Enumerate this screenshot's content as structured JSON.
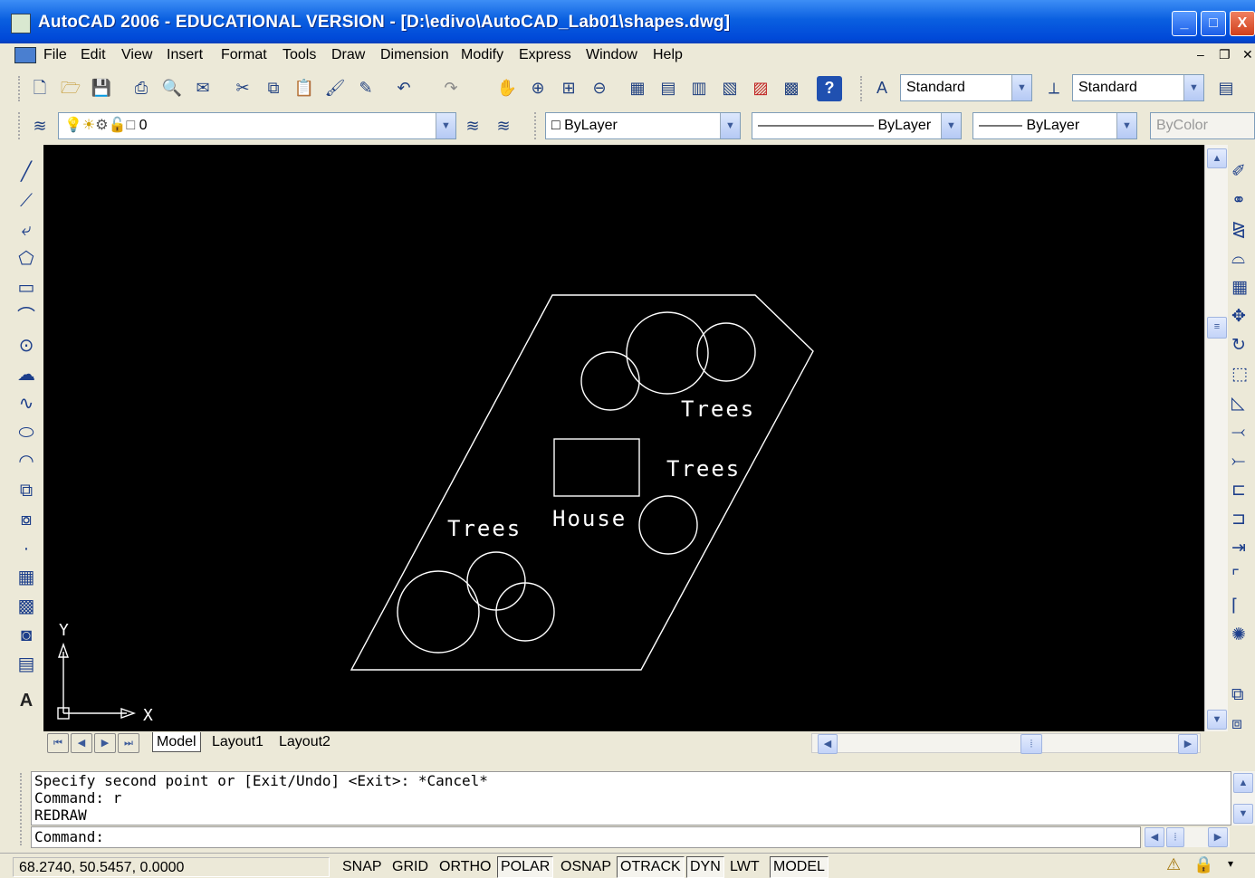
{
  "window": {
    "title": "AutoCAD 2006 - EDUCATIONAL VERSION - [D:\\edivo\\AutoCAD_Lab01\\shapes.dwg]",
    "minimize": "_",
    "maximize": "□",
    "close": "X"
  },
  "menu": [
    "File",
    "Edit",
    "View",
    "Insert",
    "Format",
    "Tools",
    "Draw",
    "Dimension",
    "Modify",
    "Express",
    "Window",
    "Help"
  ],
  "styles": {
    "text_style": "Standard",
    "dim_style": "Standard"
  },
  "layers": {
    "current_layer": "0",
    "color": "ByLayer",
    "linetype": "ByLayer",
    "lineweight": "ByLayer",
    "plotstyle": "ByColor"
  },
  "drawing": {
    "labels": [
      "Trees",
      "Trees",
      "House",
      "Trees"
    ],
    "ucs_x": "X",
    "ucs_y": "Y"
  },
  "tabs": [
    "Model",
    "Layout1",
    "Layout2"
  ],
  "active_tab": "Model",
  "command_history": [
    "Specify second point or [Exit/Undo] <Exit>: *Cancel*",
    "Command: r",
    "REDRAW"
  ],
  "command_prompt": "Command:",
  "status": {
    "coordinates": "68.2740, 50.5457, 0.0000",
    "toggles": [
      {
        "label": "SNAP",
        "on": false
      },
      {
        "label": "GRID",
        "on": false
      },
      {
        "label": "ORTHO",
        "on": false
      },
      {
        "label": "POLAR",
        "on": true
      },
      {
        "label": "OSNAP",
        "on": false
      },
      {
        "label": "OTRACK",
        "on": true
      },
      {
        "label": "DYN",
        "on": true
      },
      {
        "label": "LWT",
        "on": false
      },
      {
        "label": "MODEL",
        "on": true
      }
    ]
  },
  "colors": {
    "titlebar": "#0a5fe0",
    "canvas": "#000000",
    "geometry": "#ffffff",
    "chrome": "#ece9d8"
  }
}
